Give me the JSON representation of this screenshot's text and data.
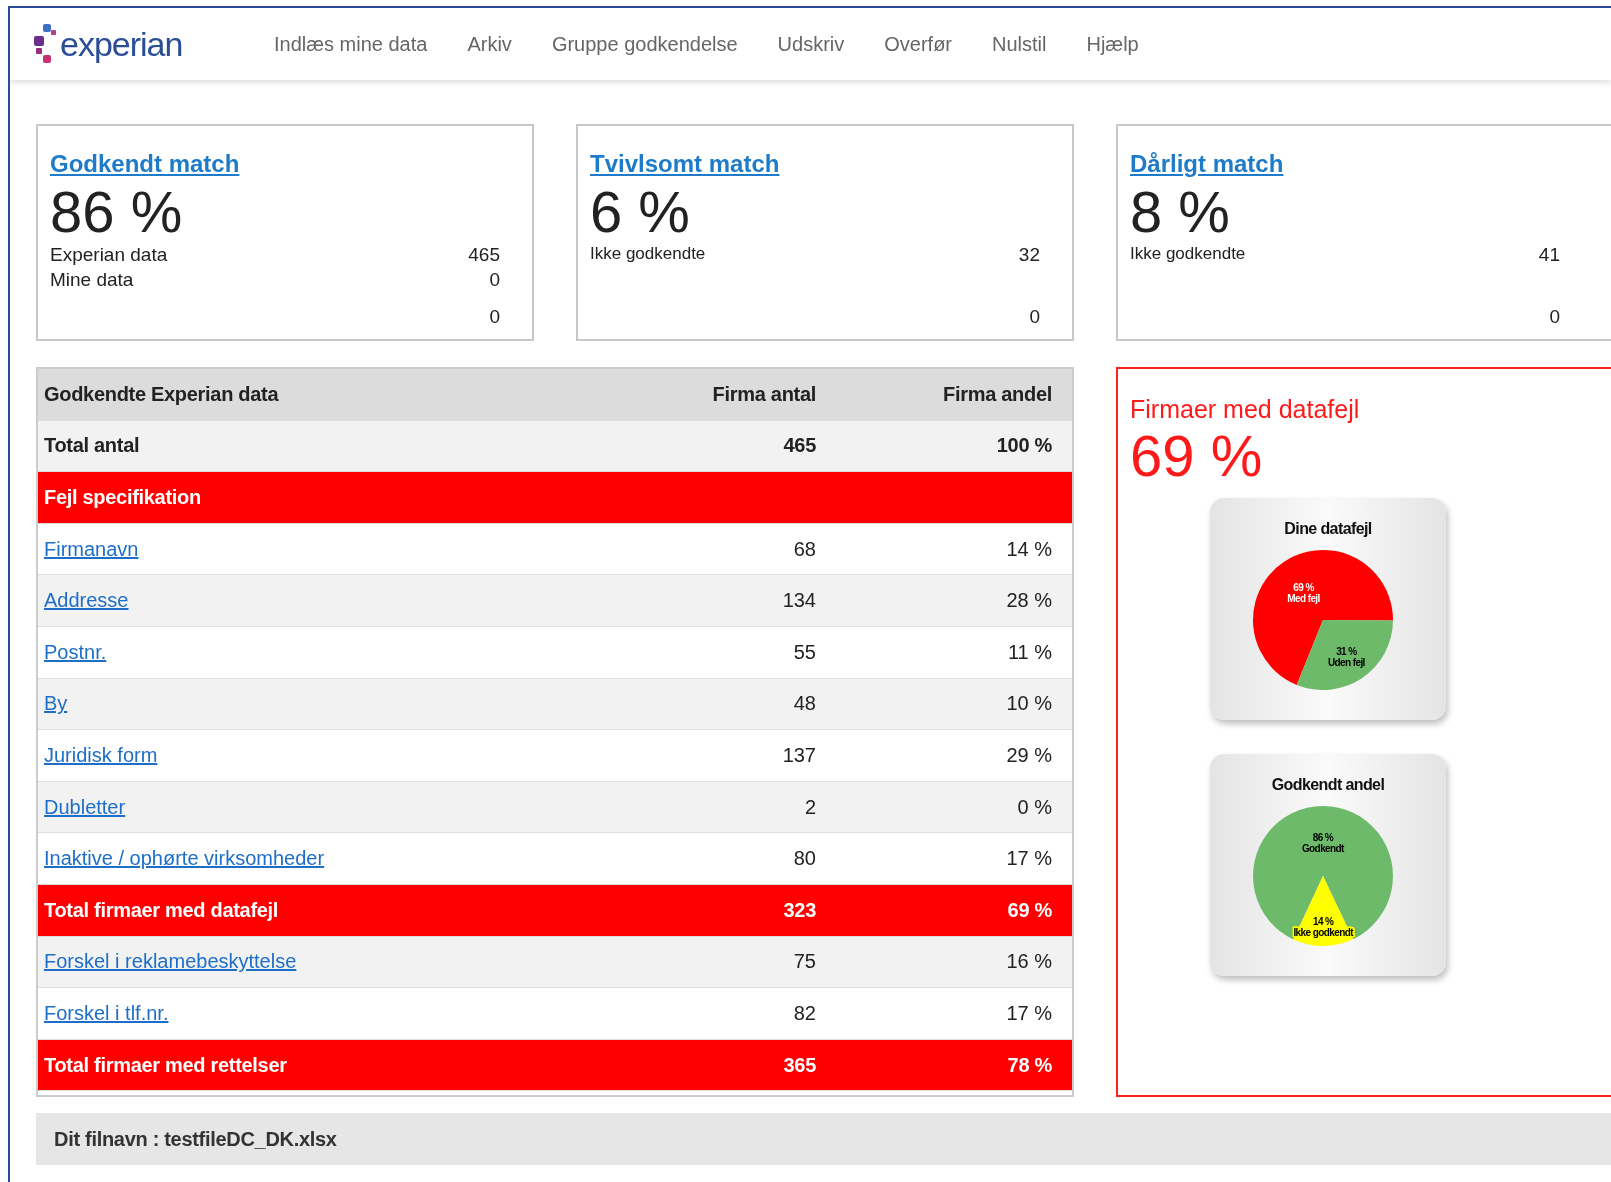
{
  "logo": {
    "text": "experian"
  },
  "nav": [
    {
      "label": "Indlæs mine data"
    },
    {
      "label": "Arkiv"
    },
    {
      "label": "Gruppe godkendelse"
    },
    {
      "label": "Udskriv"
    },
    {
      "label": "Overfør"
    },
    {
      "label": "Nulstil"
    },
    {
      "label": "Hjælp"
    }
  ],
  "cards": [
    {
      "title": "Godkendt match",
      "percent": "86 %",
      "lines": [
        {
          "label": "Experian data",
          "value": "465"
        },
        {
          "label": "Mine data",
          "value": "0"
        },
        {
          "value": "0"
        }
      ]
    },
    {
      "title": "Tvivlsomt match",
      "percent": "6 %",
      "lines": [
        {
          "label": "Ikke godkendte",
          "value": "32"
        },
        {
          "value": "0"
        }
      ]
    },
    {
      "title": "Dårligt match",
      "percent": "8 %",
      "lines": [
        {
          "label": "Ikke godkendte",
          "value": "41"
        },
        {
          "value": "0"
        }
      ]
    }
  ],
  "table": {
    "rows": [
      {
        "kind": "header",
        "label": "Godkendte Experian data",
        "count": "Firma antal",
        "share": "Firma andel"
      },
      {
        "kind": "total",
        "label": "Total antal",
        "count": "465",
        "share": "100 %"
      },
      {
        "kind": "section",
        "label": "Fejl specifikation"
      },
      {
        "kind": "link",
        "label": "Firmanavn",
        "count": "68",
        "share": "14 %"
      },
      {
        "kind": "link",
        "label": "Addresse",
        "count": "134",
        "share": "28 %"
      },
      {
        "kind": "link",
        "label": "Postnr.",
        "count": "55",
        "share": "11 %"
      },
      {
        "kind": "link",
        "label": "By",
        "count": "48",
        "share": "10 %"
      },
      {
        "kind": "link",
        "label": "Juridisk form",
        "count": "137",
        "share": "29 %"
      },
      {
        "kind": "link",
        "label": "Dubletter",
        "count": "2",
        "share": "0 %"
      },
      {
        "kind": "link",
        "label": "Inaktive / ophørte virksomheder",
        "count": "80",
        "share": "17 %"
      },
      {
        "kind": "sum",
        "label": "Total firmaer med datafejl",
        "count": "323",
        "share": "69 %"
      },
      {
        "kind": "link",
        "label": "Forskel i reklamebeskyttelse",
        "count": "75",
        "share": "16 %"
      },
      {
        "kind": "link",
        "label": "Forskel i tlf.nr.",
        "count": "82",
        "share": "17 %"
      },
      {
        "kind": "sum",
        "label": "Total firmaer med rettelser",
        "count": "365",
        "share": "78 %"
      }
    ]
  },
  "error_panel": {
    "title": "Firmaer med datafejl",
    "percent": "69 %",
    "charts": [
      {
        "chart_data": {
          "type": "pie",
          "categories": [
            "Med fejl",
            "Uden fejl"
          ],
          "title": "Dine datafejl",
          "series": [
            {
              "values": [
                69,
                31
              ]
            }
          ],
          "colors": [
            "#ff0000",
            "#6dbb6a"
          ],
          "value_labels": [
            "69 %",
            "31 %"
          ]
        }
      },
      {
        "chart_data": {
          "type": "pie",
          "categories": [
            "Godkendt",
            "Ikke godkendt"
          ],
          "title": "Godkendt andel",
          "series": [
            {
              "values": [
                86,
                14
              ]
            }
          ],
          "colors": [
            "#6dbb6a",
            "#ffff00"
          ],
          "value_labels": [
            "86 %",
            "14 %"
          ]
        }
      }
    ]
  },
  "footer": {
    "text": "Dit filnavn : testfileDC_DK.xlsx"
  }
}
